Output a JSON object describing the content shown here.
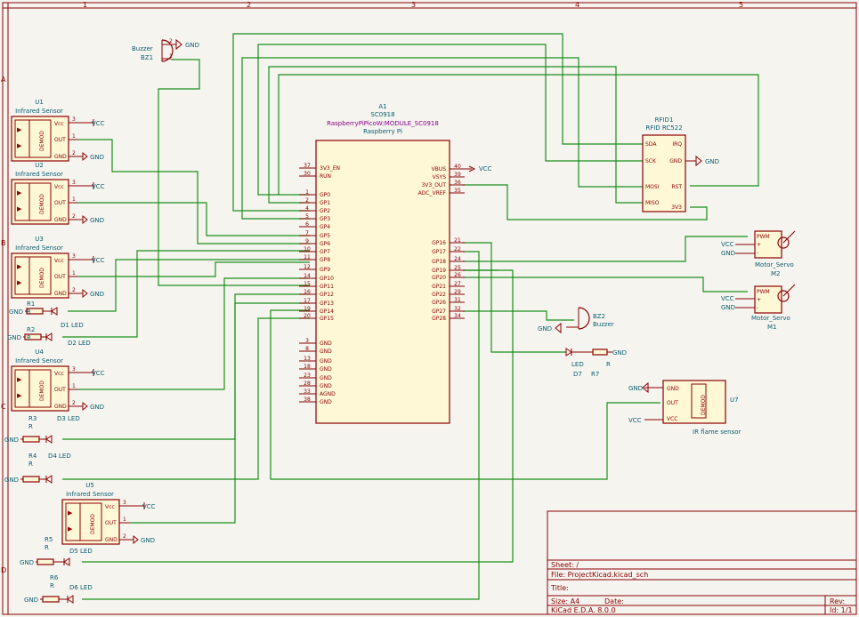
{
  "sheet": {
    "cols": [
      "1",
      "2",
      "3",
      "4",
      "5"
    ],
    "rows": [
      "A",
      "B",
      "C",
      "D"
    ],
    "title_block": {
      "sheet": "Sheet: /",
      "file": "File: ProjectKicad.kicad_sch",
      "title": "Title:",
      "size": "Size: A4",
      "date": "Date:",
      "rev": "Rev:",
      "tool": "KiCad E.D.A. 8.0.0",
      "id": "Id: 1/1"
    }
  },
  "pico": {
    "ref": "A1",
    "value1": "SC0918",
    "value2": "RaspberryPiPicoW:MODULE_SC0918",
    "footprint": "Raspberry Pi",
    "left_pins": [
      {
        "num": "37",
        "name": "3V3_EN"
      },
      {
        "num": "30",
        "name": "RUN"
      },
      {
        "num": "1",
        "name": "GP0"
      },
      {
        "num": "2",
        "name": "GP1"
      },
      {
        "num": "4",
        "name": "GP2"
      },
      {
        "num": "5",
        "name": "GP3"
      },
      {
        "num": "6",
        "name": "GP4"
      },
      {
        "num": "7",
        "name": "GP5"
      },
      {
        "num": "9",
        "name": "GP6"
      },
      {
        "num": "10",
        "name": "GP7"
      },
      {
        "num": "11",
        "name": "GP8"
      },
      {
        "num": "12",
        "name": "GP9"
      },
      {
        "num": "14",
        "name": "GP10"
      },
      {
        "num": "15",
        "name": "GP11"
      },
      {
        "num": "16",
        "name": "GP12"
      },
      {
        "num": "17",
        "name": "GP13"
      },
      {
        "num": "19",
        "name": "GP14"
      },
      {
        "num": "20",
        "name": "GP15"
      },
      {
        "num": "3",
        "name": "GND"
      },
      {
        "num": "8",
        "name": "GND"
      },
      {
        "num": "13",
        "name": "GND"
      },
      {
        "num": "18",
        "name": "GND"
      },
      {
        "num": "23",
        "name": "GND"
      },
      {
        "num": "28",
        "name": "GND"
      },
      {
        "num": "33",
        "name": "AGND"
      },
      {
        "num": "38",
        "name": "GND"
      }
    ],
    "right_pins": [
      {
        "num": "40",
        "name": "VBUS"
      },
      {
        "num": "39",
        "name": "VSYS"
      },
      {
        "num": "36",
        "name": "3V3_OUT"
      },
      {
        "num": "35",
        "name": "ADC_VREF"
      },
      {
        "num": "21",
        "name": "GP16"
      },
      {
        "num": "22",
        "name": "GP17"
      },
      {
        "num": "24",
        "name": "GP18"
      },
      {
        "num": "25",
        "name": "GP19"
      },
      {
        "num": "26",
        "name": "GP20"
      },
      {
        "num": "27",
        "name": "GP21"
      },
      {
        "num": "29",
        "name": "GP22"
      },
      {
        "num": "31",
        "name": "GP26"
      },
      {
        "num": "32",
        "name": "GP27"
      },
      {
        "num": "34",
        "name": "GP28"
      }
    ],
    "vcc": "VCC"
  },
  "sensors": [
    {
      "ref": "U1",
      "value": "Infrared Sensor"
    },
    {
      "ref": "U2",
      "value": "Infrared Sensor"
    },
    {
      "ref": "U3",
      "value": "Infrared Sensor"
    },
    {
      "ref": "U4",
      "value": "Infrared Sensor"
    },
    {
      "ref": "U5",
      "value": "Infrared Sensor"
    }
  ],
  "sensor_pins": {
    "vcc": "Vcc",
    "out": "OUT",
    "gnd": "GND",
    "demod": "DEMOD",
    "p3": "3",
    "p1": "1",
    "p2": "2"
  },
  "nets": {
    "vcc": "VCC",
    "gnd": "GND"
  },
  "leds": [
    {
      "ref": "D1",
      "value": "LED",
      "r_ref": "R1",
      "r_val": "R"
    },
    {
      "ref": "D2",
      "value": "LED",
      "r_ref": "R2",
      "r_val": "R"
    },
    {
      "ref": "D3",
      "value": "LED",
      "r_ref": "R3",
      "r_val": "R"
    },
    {
      "ref": "D4",
      "value": "LED",
      "r_ref": "R4",
      "r_val": "R"
    },
    {
      "ref": "D5",
      "value": "LED",
      "r_ref": "R5",
      "r_val": "R"
    },
    {
      "ref": "D6",
      "value": "LED",
      "r_ref": "R6",
      "r_val": "R"
    },
    {
      "ref": "D7",
      "value": "LED",
      "r_ref": "R7",
      "r_val": "R"
    }
  ],
  "buzzer1": {
    "ref": "BZ1",
    "value": "Buzzer"
  },
  "buzzer2": {
    "ref": "BZ2",
    "value": "Buzzer"
  },
  "rfid": {
    "ref": "RFID1",
    "value": "RFID RC522",
    "pins_left": [
      "SDA",
      "SCK",
      "MOSI",
      "MISO"
    ],
    "pins_right": [
      "IRQ",
      "GND",
      "RST",
      "3V3"
    ]
  },
  "servos": [
    {
      "ref": "M2",
      "value": "Motor_Servo",
      "pwm": "PWM"
    },
    {
      "ref": "M1",
      "value": "Motor_Servo",
      "pwm": "PWM"
    }
  ],
  "flame": {
    "ref": "U7",
    "value": "IR flame sensor",
    "pins": [
      "GND",
      "OUT",
      "VCC"
    ],
    "demod": "DEMOD"
  }
}
